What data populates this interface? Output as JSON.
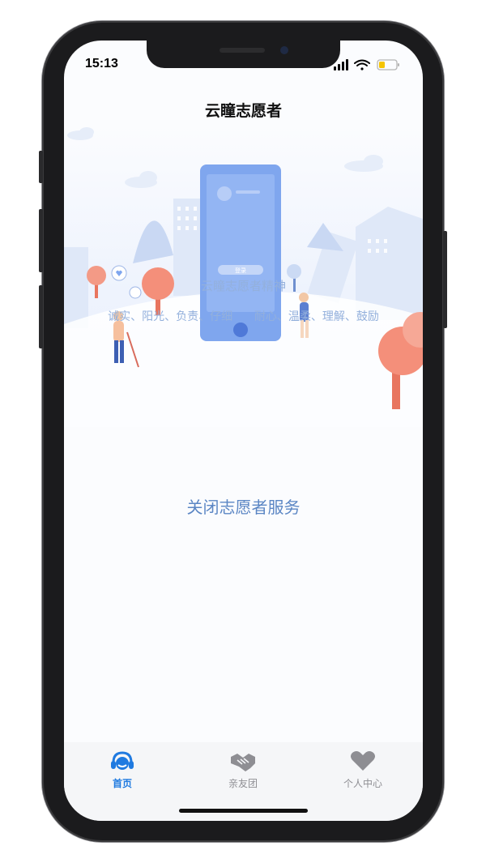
{
  "status_bar": {
    "time": "15:13"
  },
  "header": {
    "title": "云瞳志愿者"
  },
  "hero": {
    "spirit_title": "云瞳志愿者精神",
    "values_left": "诚实、阳光、负责、仔细",
    "values_right": "耐心、温柔、理解、鼓励",
    "phone_button_label": "登录"
  },
  "main": {
    "service_toggle_label": "关闭志愿者服务"
  },
  "tabbar": {
    "tabs": [
      {
        "label": "首页",
        "icon": "headset-icon",
        "color": "#1f7ae0"
      },
      {
        "label": "亲友团",
        "icon": "handshake-icon",
        "color": "#8e8e93"
      },
      {
        "label": "个人中心",
        "icon": "heart-icon",
        "color": "#8e8e93"
      }
    ]
  },
  "colors": {
    "accent": "#1f7ae0",
    "hero_text": "#93b0dc",
    "toggle_text": "#5b86c4"
  }
}
